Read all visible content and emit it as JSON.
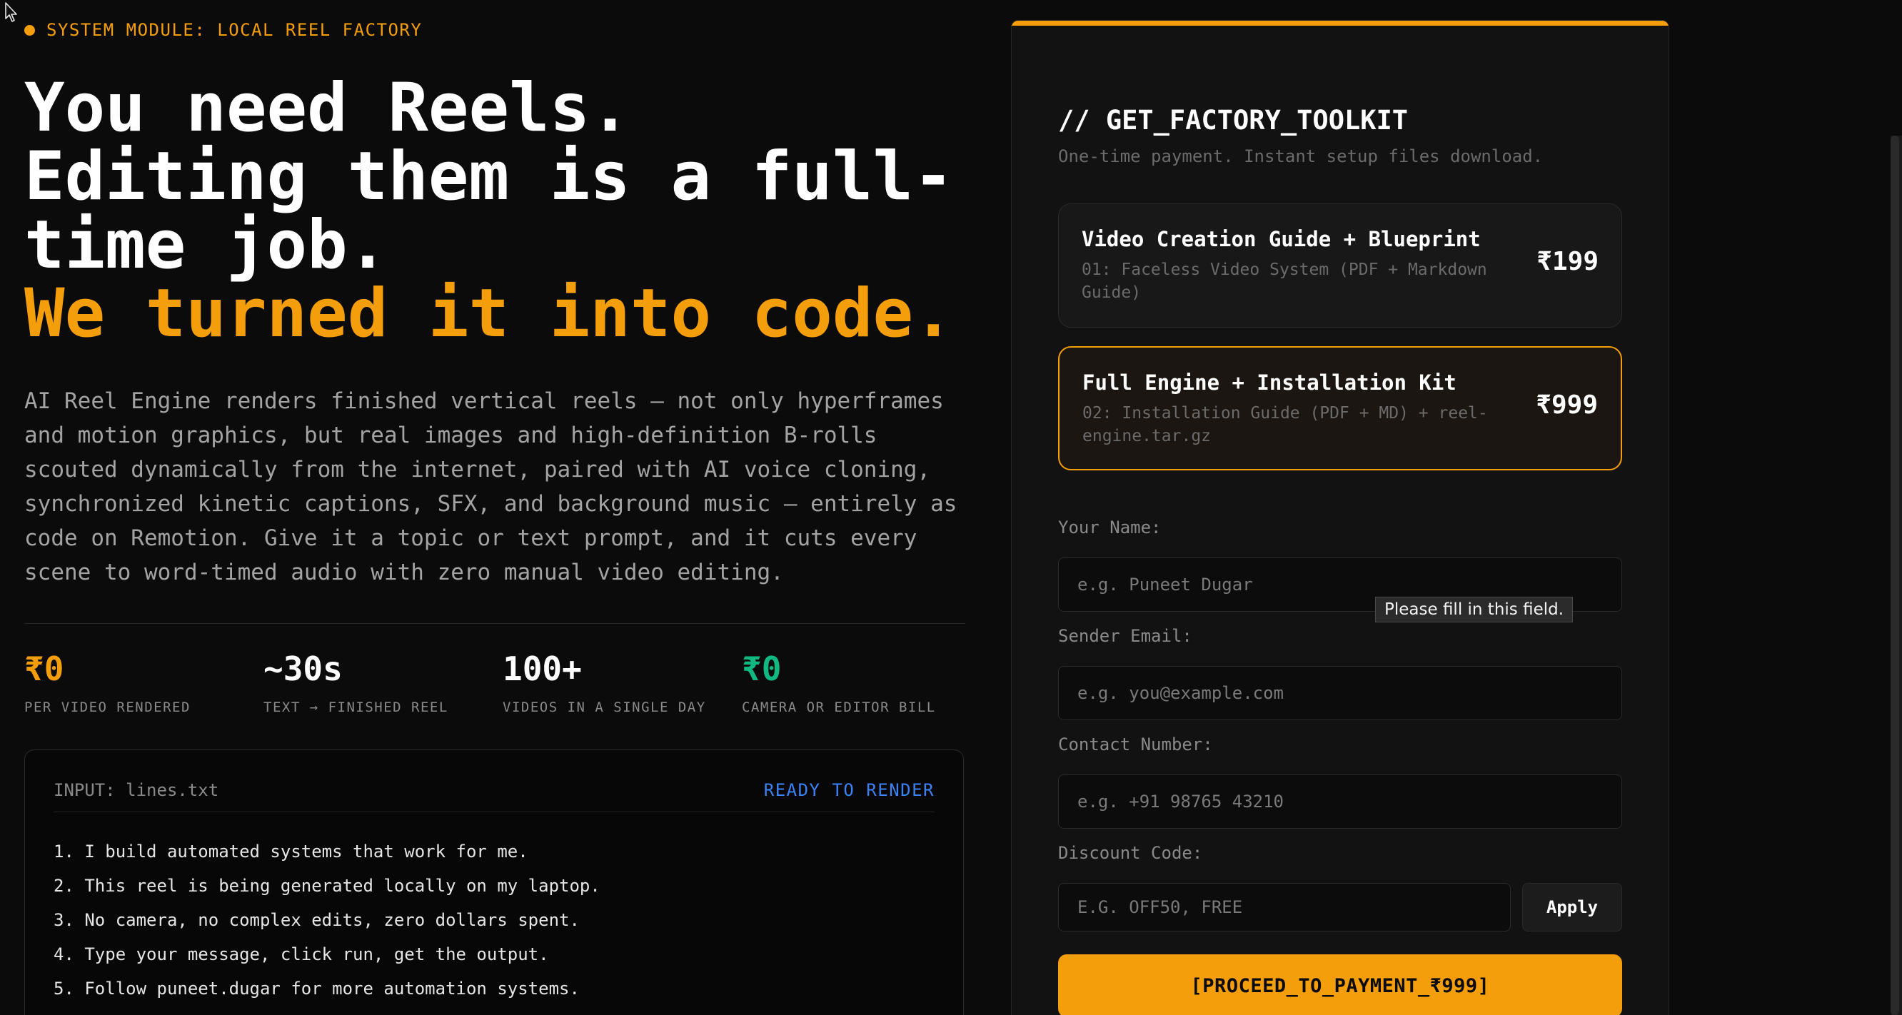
{
  "hero": {
    "module_tag": "SYSTEM MODULE: LOCAL REEL FACTORY",
    "headline_line1": "You need Reels.",
    "headline_line2": "Editing them is a full-",
    "headline_line3": "time job.",
    "headline_accent": "We turned it into code.",
    "lede": "AI Reel Engine renders finished vertical reels — not only hyperframes and motion graphics, but real images and high-definition B-rolls scouted dynamically from the internet, paired with AI voice cloning, synchronized kinetic captions, SFX, and background music — entirely as code on Remotion. Give it a topic or text prompt, and it cuts every scene to word-timed audio with zero manual video editing."
  },
  "stats": [
    {
      "value": "₹0",
      "label": "PER VIDEO RENDERED",
      "color": "#f59e0b"
    },
    {
      "value": "~30s",
      "label": "TEXT → FINISHED REEL",
      "color": "#ffffff"
    },
    {
      "value": "100+",
      "label": "VIDEOS IN A SINGLE DAY",
      "color": "#ffffff"
    },
    {
      "value": "₹0",
      "label": "CAMERA OR EDITOR BILL",
      "color": "#10b981"
    }
  ],
  "terminal": {
    "input_label": "INPUT: lines.txt",
    "status": "READY TO RENDER",
    "lines": [
      "1. I build automated systems that work for me.",
      "2. This reel is being generated locally on my laptop.",
      "3. No camera, no complex edits, zero dollars spent.",
      "4. Type your message, click run, get the output.",
      "5. Follow puneet.dugar for more automation systems."
    ]
  },
  "checkout": {
    "title": "// GET_FACTORY_TOOLKIT",
    "subtitle": "One-time payment. Instant setup files download.",
    "plans": [
      {
        "name": "Video Creation Guide + Blueprint",
        "description": "01: Faceless Video System (PDF + Markdown Guide)",
        "price": "₹199",
        "selected": false
      },
      {
        "name": "Full Engine + Installation Kit",
        "description": "02: Installation Guide (PDF + MD) + reel-engine.tar.gz",
        "price": "₹999",
        "selected": true
      }
    ],
    "fields": {
      "name_label": "Your Name:",
      "name_placeholder": "e.g. Puneet Dugar",
      "email_label": "Sender Email:",
      "email_placeholder": "e.g. you@example.com",
      "phone_label": "Contact Number:",
      "phone_placeholder": "e.g. +91 98765 43210",
      "discount_label": "Discount Code:",
      "discount_placeholder": "e.g. OFF50, FREE"
    },
    "apply_label": "Apply",
    "pay_label": "[PROCEED_TO_PAYMENT_₹999]",
    "validation_tooltip": "Please fill in this field."
  },
  "colors": {
    "accent": "#f59e0b",
    "success": "#10b981",
    "status_blue": "#3b82f6",
    "background": "#0b0b0b"
  }
}
